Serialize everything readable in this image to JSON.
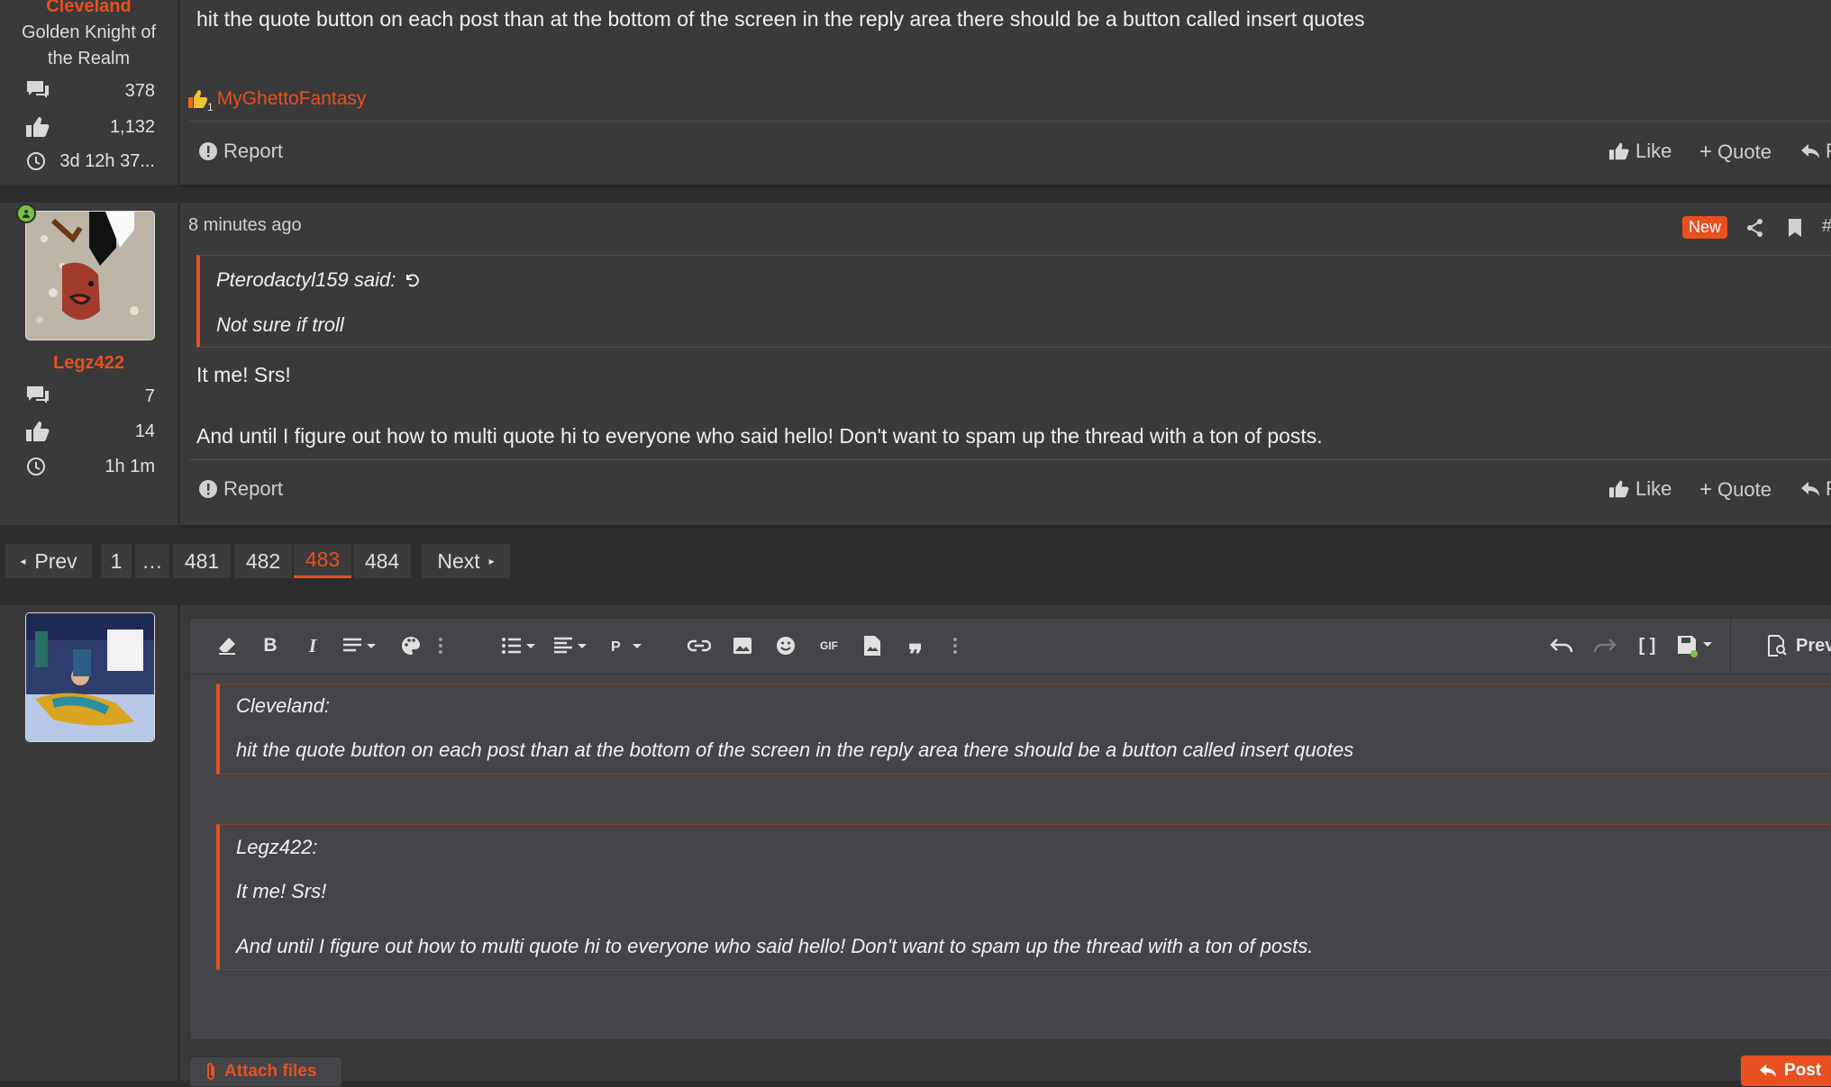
{
  "post1": {
    "author": "Cleveland",
    "user_title": "Golden Knight of the Realm",
    "stats": {
      "messages": "378",
      "reactions": "1,132",
      "time": "3d 12h 37..."
    },
    "body": "hit the quote button on each post than at the bottom of the screen in the reply area there should be a button called insert quotes",
    "reaction_count": "1",
    "reaction_user": "MyGhettoFantasy",
    "report_label": "Report",
    "like_label": "Like",
    "quote_label": "Quote"
  },
  "post2": {
    "author": "Legz422",
    "time": "8 minutes ago",
    "new_badge": "New",
    "stats": {
      "messages": "7",
      "reactions": "14",
      "time": "1h 1m"
    },
    "quote_author": "Pterodactyl159 said:",
    "quote_text": "Not sure if troll",
    "body_line1": "It me! Srs!",
    "body_line2": "And until I figure out how to multi quote hi to everyone who said hello! Don't want to spam up the thread with a ton of posts.",
    "report_label": "Report",
    "like_label": "Like",
    "quote_label": "Quote"
  },
  "pagination": {
    "prev": "Prev",
    "pages": [
      "1",
      "…",
      "481",
      "482",
      "483",
      "484"
    ],
    "current": "483",
    "next": "Next"
  },
  "editor": {
    "preview_label": "Prev",
    "quote1_author": "Cleveland:",
    "quote1_text": "hit the quote button on each post than at the bottom of the screen in the reply area there should be a button called insert quotes",
    "quote2_author": "Legz422:",
    "quote2_line1": "It me! Srs!",
    "quote2_line2": "And until I figure out how to multi quote hi to everyone who said hello! Don't want to spam up the thread with a ton of posts.",
    "attach_label": "Attach files",
    "post_label": "Post"
  },
  "colors": {
    "accent": "#e8501f",
    "bg": "#2d2d2d",
    "panel": "#3a3a3a",
    "editor": "#444549",
    "online": "#7bc142"
  }
}
